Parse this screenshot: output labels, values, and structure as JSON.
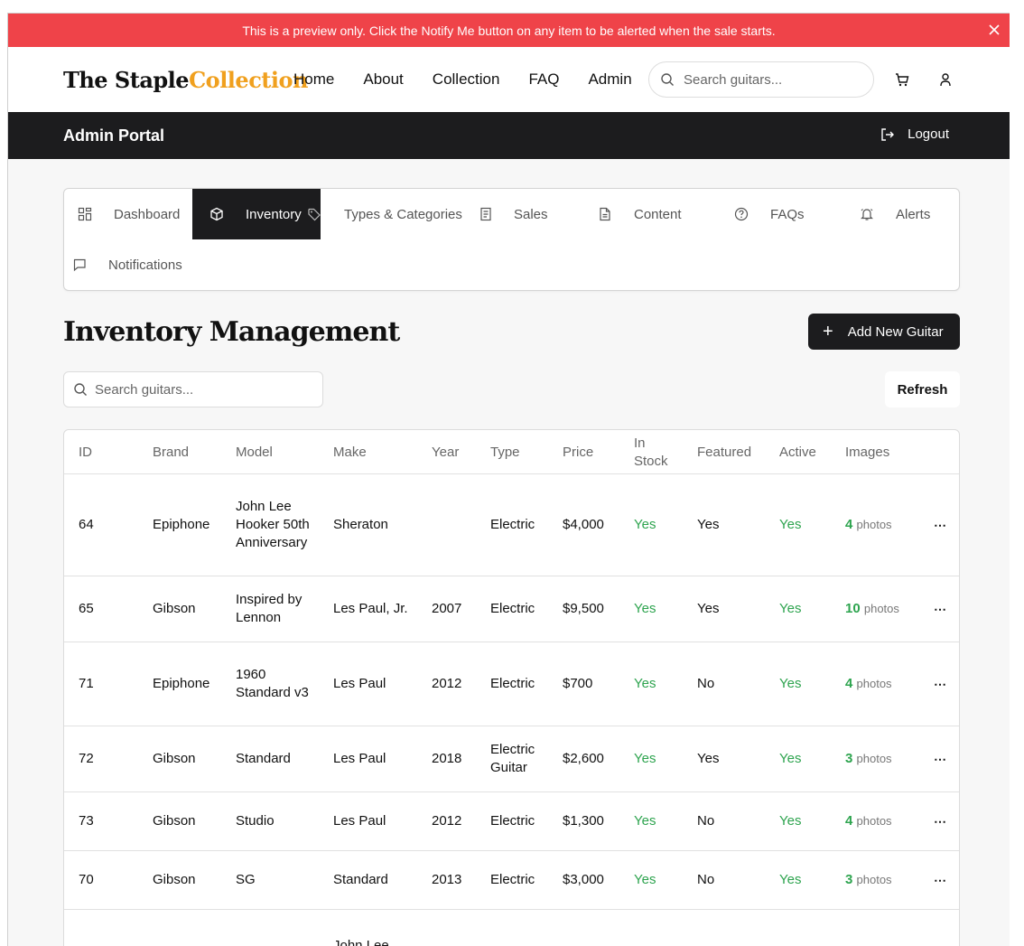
{
  "banner": {
    "text": "This is a preview only. Click the Notify Me button on any item to be alerted when the sale starts.",
    "close_label": "×"
  },
  "header": {
    "logo_part1": "The Staple",
    "logo_part2": "Collection",
    "nav": [
      "Home",
      "About",
      "Collection",
      "FAQ",
      "Admin"
    ],
    "search_placeholder": "Search guitars..."
  },
  "adminbar": {
    "title": "Admin Portal",
    "logout_label": "Logout"
  },
  "tabs": [
    {
      "label": "Dashboard",
      "icon": "dashboard-icon"
    },
    {
      "label": "Inventory",
      "icon": "box-icon",
      "active": true
    },
    {
      "label": "Types & Categories",
      "icon": "tag-icon"
    },
    {
      "label": "Sales",
      "icon": "receipt-icon"
    },
    {
      "label": "Content",
      "icon": "document-icon"
    },
    {
      "label": "FAQs",
      "icon": "help-circle-icon"
    },
    {
      "label": "Alerts",
      "icon": "bell-icon"
    },
    {
      "label": "Notifications",
      "icon": "message-icon"
    }
  ],
  "main": {
    "title": "Inventory Management",
    "add_button": "Add New Guitar",
    "add_plus": "+",
    "search_placeholder": "Search guitars...",
    "refresh_label": "Refresh"
  },
  "table": {
    "headers": [
      "ID",
      "Brand",
      "Model",
      "Make",
      "Year",
      "Type",
      "Price",
      "In Stock",
      "Featured",
      "Active",
      "Images"
    ],
    "photos_word": "photos",
    "rows": [
      {
        "id": "64",
        "brand": "Epiphone",
        "model": "John Lee Hooker 50th Anniversary",
        "make": "Sheraton",
        "year": "",
        "type": "Electric",
        "price": "$4,000",
        "in_stock": "Yes",
        "featured": "Yes",
        "active": "Yes",
        "images": "4"
      },
      {
        "id": "65",
        "brand": "Gibson",
        "model": "Inspired by Lennon",
        "make": "Les Paul, Jr.",
        "year": "2007",
        "type": "Electric",
        "price": "$9,500",
        "in_stock": "Yes",
        "featured": "Yes",
        "active": "Yes",
        "images": "10"
      },
      {
        "id": "71",
        "brand": "Epiphone",
        "model": "1960 Standard v3",
        "make": "Les Paul",
        "year": "2012",
        "type": "Electric",
        "price": "$700",
        "in_stock": "Yes",
        "featured": "No",
        "active": "Yes",
        "images": "4"
      },
      {
        "id": "72",
        "brand": "Gibson",
        "model": "Standard",
        "make": "Les Paul",
        "year": "2018",
        "type": "Electric Guitar",
        "price": "$2,600",
        "in_stock": "Yes",
        "featured": "Yes",
        "active": "Yes",
        "images": "3"
      },
      {
        "id": "73",
        "brand": "Gibson",
        "model": "Studio",
        "make": "Les Paul",
        "year": "2012",
        "type": "Electric",
        "price": "$1,300",
        "in_stock": "Yes",
        "featured": "No",
        "active": "Yes",
        "images": "4"
      },
      {
        "id": "70",
        "brand": "Gibson",
        "model": "SG",
        "make": "Standard",
        "year": "2013",
        "type": "Electric",
        "price": "$3,000",
        "in_stock": "Yes",
        "featured": "No",
        "active": "Yes",
        "images": "3"
      },
      {
        "id": "",
        "brand": "",
        "model": "",
        "make": "John Lee",
        "year": "",
        "type": "",
        "price": "",
        "in_stock": "",
        "featured": "",
        "active": "",
        "images": ""
      }
    ]
  },
  "colors": {
    "banner": "#ef4349",
    "accent_logo": "#f0a01e",
    "dark": "#1c1c1e",
    "positive": "#2ea44f"
  }
}
